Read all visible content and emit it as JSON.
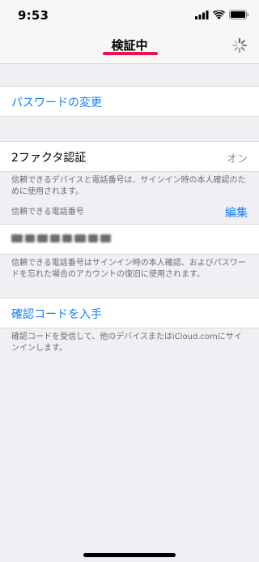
{
  "status_bar": {
    "time": "9:53",
    "icons": [
      "signal-icon",
      "wifi-icon",
      "battery-icon"
    ]
  },
  "nav": {
    "title": "検証中",
    "activity": "spinner-icon",
    "underline_color": "#e9124e"
  },
  "password_change": {
    "label": "パスワードの変更"
  },
  "two_factor": {
    "label": "2ファクタ認証",
    "value": "オン",
    "description": "信頼できるデバイスと電話番号は、サインイン時の本人確認のために使用されます。"
  },
  "trusted_numbers": {
    "header": "信頼できる電話番号",
    "edit_label": "編集",
    "number_blurred": true,
    "description": "信頼できる電話番号はサインイン時の本人確認、およびパスワードを忘れた場合のアカウントの復旧に使用されます。"
  },
  "verification_code": {
    "label": "確認コードを入手",
    "description": "確認コードを受信して、他のデバイスまたはiCloud.comにサインインします。"
  },
  "colors": {
    "link": "#157efb",
    "background": "#efeff4",
    "secondary_text": "#6d6d72"
  }
}
